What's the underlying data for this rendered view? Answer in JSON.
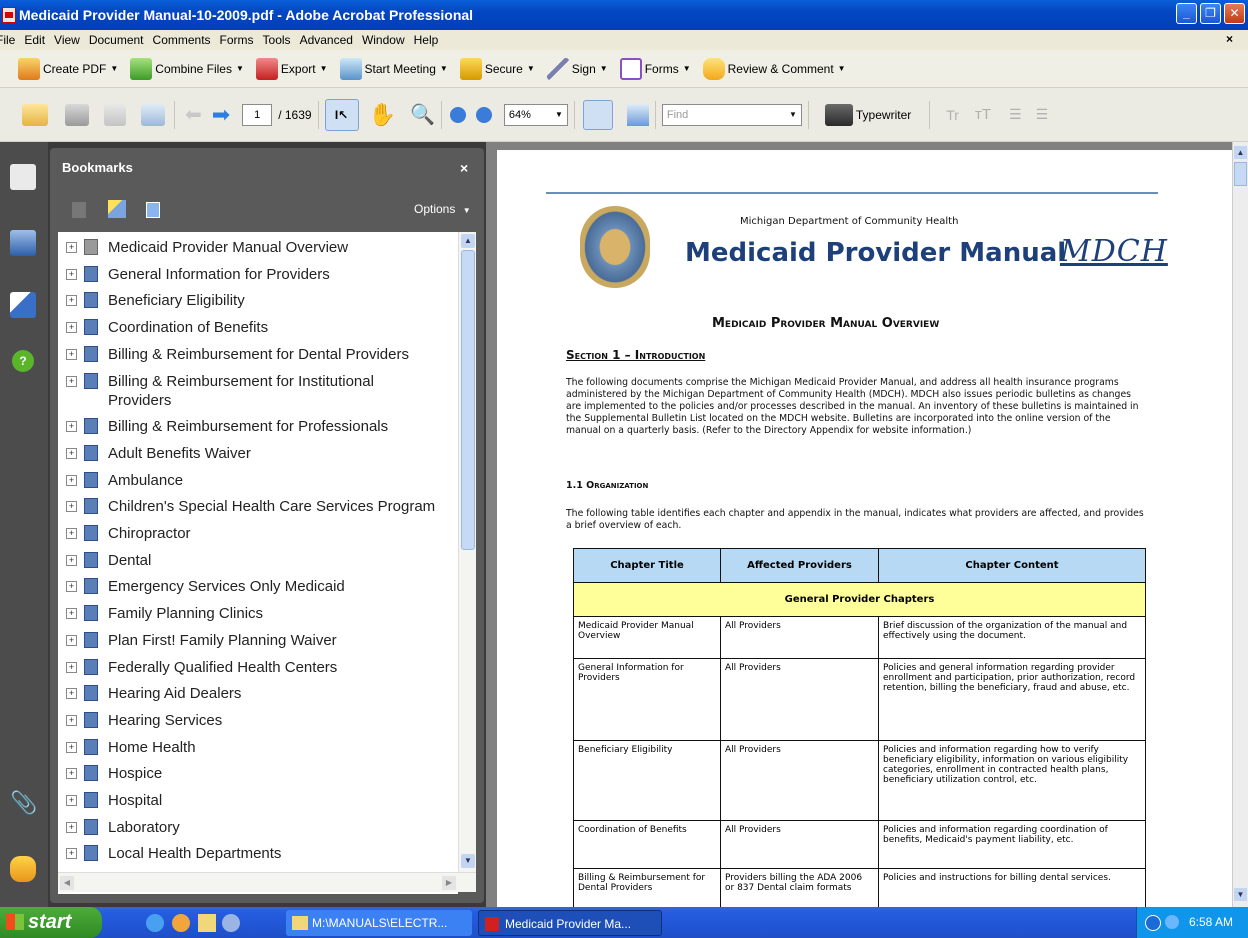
{
  "window": {
    "title": "Medicaid Provider Manual-10-2009.pdf - Adobe Acrobat Professional"
  },
  "menu": [
    "File",
    "Edit",
    "View",
    "Document",
    "Comments",
    "Forms",
    "Tools",
    "Advanced",
    "Window",
    "Help"
  ],
  "toolbar1": {
    "create_pdf": "Create PDF",
    "combine_files": "Combine Files",
    "export": "Export",
    "start_meeting": "Start Meeting",
    "secure": "Secure",
    "sign": "Sign",
    "forms": "Forms",
    "review_comment": "Review & Comment"
  },
  "toolbar2": {
    "page_number": "1",
    "page_total": "/ 1639",
    "zoom": "64%",
    "find_placeholder": "Find",
    "typewriter": "Typewriter"
  },
  "bookmarks": {
    "title": "Bookmarks",
    "options": "Options",
    "items": [
      "Medicaid Provider Manual Overview",
      "General Information for Providers",
      "Beneficiary Eligibility",
      "Coordination of Benefits",
      "Billing & Reimbursement for Dental Providers",
      "Billing & Reimbursement for Institutional Providers",
      "Billing & Reimbursement for Professionals",
      "Adult Benefits Waiver",
      "Ambulance",
      "Children's Special Health Care Services Program",
      "Chiropractor",
      "Dental",
      "Emergency Services Only Medicaid",
      "Family Planning Clinics",
      "Plan First! Family Planning Waiver",
      "Federally Qualified Health Centers",
      "Hearing Aid Dealers",
      "Hearing Services",
      "Home Health",
      "Hospice",
      "Hospital",
      "Laboratory",
      "Local Health Departments"
    ],
    "item6_line1": "Billing & Reimbursement for Institutional",
    "item6_line2": "Providers"
  },
  "document": {
    "dept": "Michigan Department of Community Health",
    "manual_title": "Medicaid Provider Manual",
    "logo_text": "MDCH",
    "overview_heading": "Medicaid Provider Manual Overview",
    "section1": "Section 1 – Introduction",
    "intro_paragraph": "The following documents comprise the Michigan Medicaid Provider Manual, and address all health insurance programs administered by the Michigan Department of Community Health (MDCH). MDCH also issues periodic bulletins as changes are implemented to the policies and/or processes described in the manual. An inventory of these bulletins is maintained in the Supplemental Bulletin List located on the MDCH website. Bulletins are incorporated into the online version of the manual on a quarterly basis. (Refer to the Directory Appendix for website information.)",
    "org_heading": "1.1 Organization",
    "org_paragraph": "The following table identifies each chapter and appendix in the manual, indicates what providers are affected, and provides a brief overview of each.",
    "table": {
      "headers": [
        "Chapter Title",
        "Affected Providers",
        "Chapter Content"
      ],
      "group": "General Provider Chapters",
      "rows": [
        [
          "Medicaid Provider Manual Overview",
          "All Providers",
          "Brief discussion of the organization of the manual and effectively using the document."
        ],
        [
          "General Information for Providers",
          "All Providers",
          "Policies and general information regarding provider enrollment and participation, prior authorization, record retention, billing the beneficiary, fraud and abuse, etc."
        ],
        [
          "Beneficiary Eligibility",
          "All Providers",
          "Policies and information regarding how to verify beneficiary eligibility, information on various eligibility categories, enrollment in contracted health plans, beneficiary utilization control, etc."
        ],
        [
          "Coordination of Benefits",
          "All Providers",
          "Policies and information regarding coordination of benefits, Medicaid's payment liability, etc."
        ],
        [
          "Billing & Reimbursement for Dental Providers",
          "Providers billing the ADA 2006 or 837 Dental claim formats",
          "Policies and instructions for billing dental services."
        ]
      ]
    }
  },
  "taskbar": {
    "start": "start",
    "task1": "M:\\MANUALS\\ELECTR...",
    "task2": "Medicaid Provider Ma...",
    "time": "6:58 AM"
  }
}
